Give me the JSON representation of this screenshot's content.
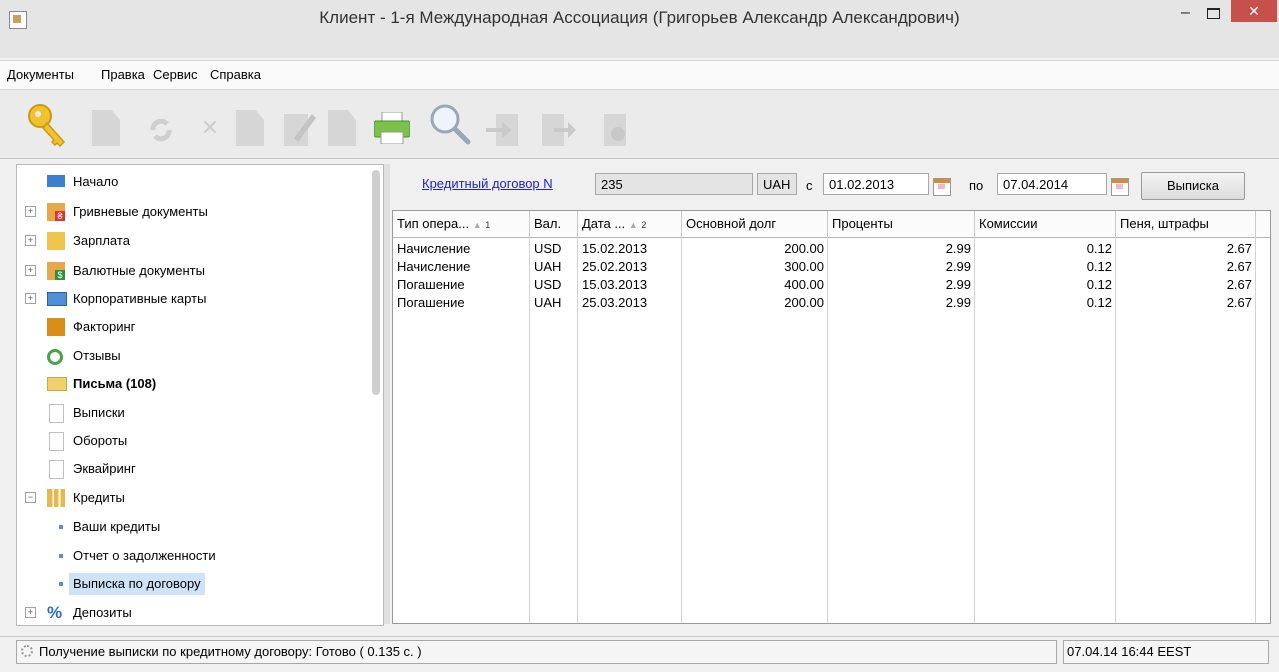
{
  "window": {
    "title": "Клиент - 1-я Международная Ассоциация (Григорьев Александр Александрович)"
  },
  "menu": [
    "Документы",
    "Правка",
    "Сервис",
    "Справка"
  ],
  "tree": [
    {
      "label": "Начало"
    },
    {
      "label": "Гривневые документы"
    },
    {
      "label": "Зарплата"
    },
    {
      "label": "Валютные документы"
    },
    {
      "label": "Корпоративные карты"
    },
    {
      "label": "Факторинг"
    },
    {
      "label": "Отзывы"
    },
    {
      "label": "Письма (108)"
    },
    {
      "label": "Выписки"
    },
    {
      "label": "Обороты"
    },
    {
      "label": "Эквайринг"
    },
    {
      "label": "Кредиты"
    },
    {
      "label": "Ваши кредиты"
    },
    {
      "label": "Отчет о задолженности"
    },
    {
      "label": "Выписка по договору"
    },
    {
      "label": "Депозиты"
    }
  ],
  "filter": {
    "link_label": "Кредитный договор N",
    "contract_no": "235",
    "currency": "UAH",
    "from_label": "с",
    "date_from": "01.02.2013",
    "to_label": "по",
    "date_to": "07.04.2014",
    "button_label": "Выписка"
  },
  "table": {
    "headers": [
      "Тип опера...",
      "Вал.",
      "Дата ...",
      "Основной долг",
      "Проценты",
      "Комиссии",
      "Пеня, штрафы"
    ],
    "sort_marks": [
      "1",
      "2"
    ],
    "rows": [
      [
        "Начисление",
        "USD",
        "15.02.2013",
        "200.00",
        "2.99",
        "0.12",
        "2.67"
      ],
      [
        "Начисление",
        "UAH",
        "25.02.2013",
        "300.00",
        "2.99",
        "0.12",
        "2.67"
      ],
      [
        "Погашение",
        "USD",
        "15.03.2013",
        "400.00",
        "2.99",
        "0.12",
        "2.67"
      ],
      [
        "Погашение",
        "UAH",
        "25.03.2013",
        "200.00",
        "2.99",
        "0.12",
        "2.67"
      ]
    ]
  },
  "status": {
    "message": "Получение выписки по кредитному договору: Готово ( 0.135 с. )",
    "datetime": "07.04.14 16:44 EEST"
  }
}
